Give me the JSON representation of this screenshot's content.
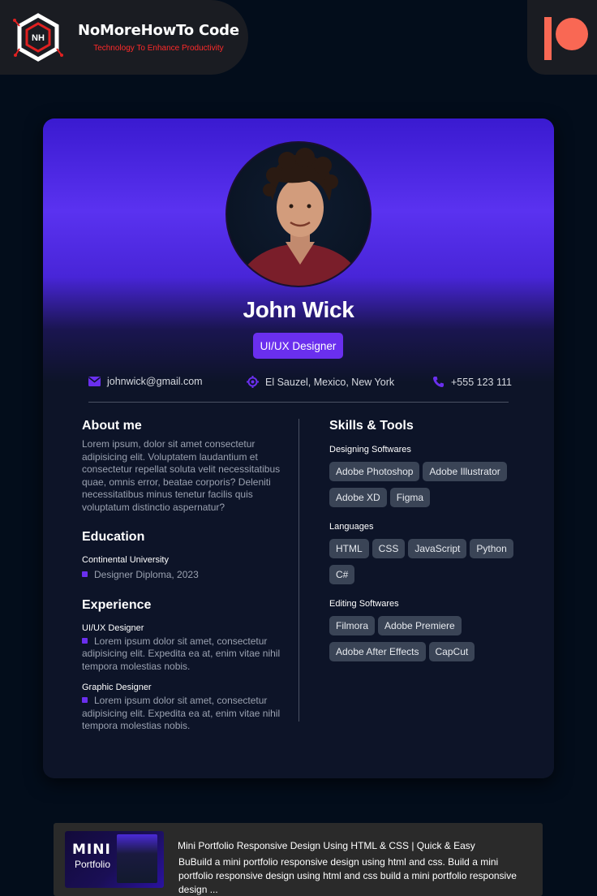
{
  "brand": {
    "title": "NoMoreHowTo Code",
    "tagline": "Technology To Enhance Productivity",
    "logo_text": "NH",
    "accent": "#ff2a2a"
  },
  "profile": {
    "name": "John Wick",
    "role": "UI/UX Designer",
    "contacts": {
      "email": "johnwick@gmail.com",
      "location": "El Sauzel, Mexico, New York",
      "phone": "+555 123 111"
    },
    "accent": "#6a2fee"
  },
  "about": {
    "title": "About me",
    "text": "Lorem ipsum, dolor sit amet consectetur adipisicing elit. Voluptatem laudantium et consectetur repellat soluta velit necessitatibus quae, omnis error, beatae corporis? Deleniti necessitatibus minus tenetur facilis quis voluptatum distinctio aspernatur?"
  },
  "education": {
    "title": "Education",
    "school": "Continental University",
    "degree": "Designer Diploma, 2023"
  },
  "experience": {
    "title": "Experience",
    "items": [
      {
        "role": "UI/UX Designer",
        "text": "Lorem ipsum dolor sit amet, consectetur adipisicing elit. Expedita ea at, enim vitae nihil tempora molestias nobis."
      },
      {
        "role": "Graphic Designer",
        "text": "Lorem ipsum dolor sit amet, consectetur adipisicing elit. Expedita ea at, enim vitae nihil tempora molestias nobis."
      }
    ]
  },
  "skills": {
    "title": "Skills & Tools",
    "groups": [
      {
        "label": "Designing Softwares",
        "items": [
          "Adobe Photoshop",
          "Adobe Illustrator",
          "Adobe XD",
          "Figma"
        ]
      },
      {
        "label": "Languages",
        "items": [
          "HTML",
          "CSS",
          "JavaScript",
          "Python",
          "C#"
        ]
      },
      {
        "label": "Editing Softwares",
        "items": [
          "Filmora",
          "Adobe Premiere",
          "Adobe After Effects",
          "CapCut"
        ]
      }
    ]
  },
  "video": {
    "title": "Mini Portfolio Responsive Design Using HTML & CSS | Quick & Easy",
    "description": "BuBuild a mini portfolio responsive design using html and css. Build a mini portfolio responsive design using html and css build a mini portfolio responsive design ...",
    "thumb_title": "MINI",
    "thumb_sub": "Portfolio"
  },
  "icons": {
    "email": "envelope-icon",
    "location": "location-target-icon",
    "phone": "phone-icon",
    "patreon": "patreon-icon"
  }
}
